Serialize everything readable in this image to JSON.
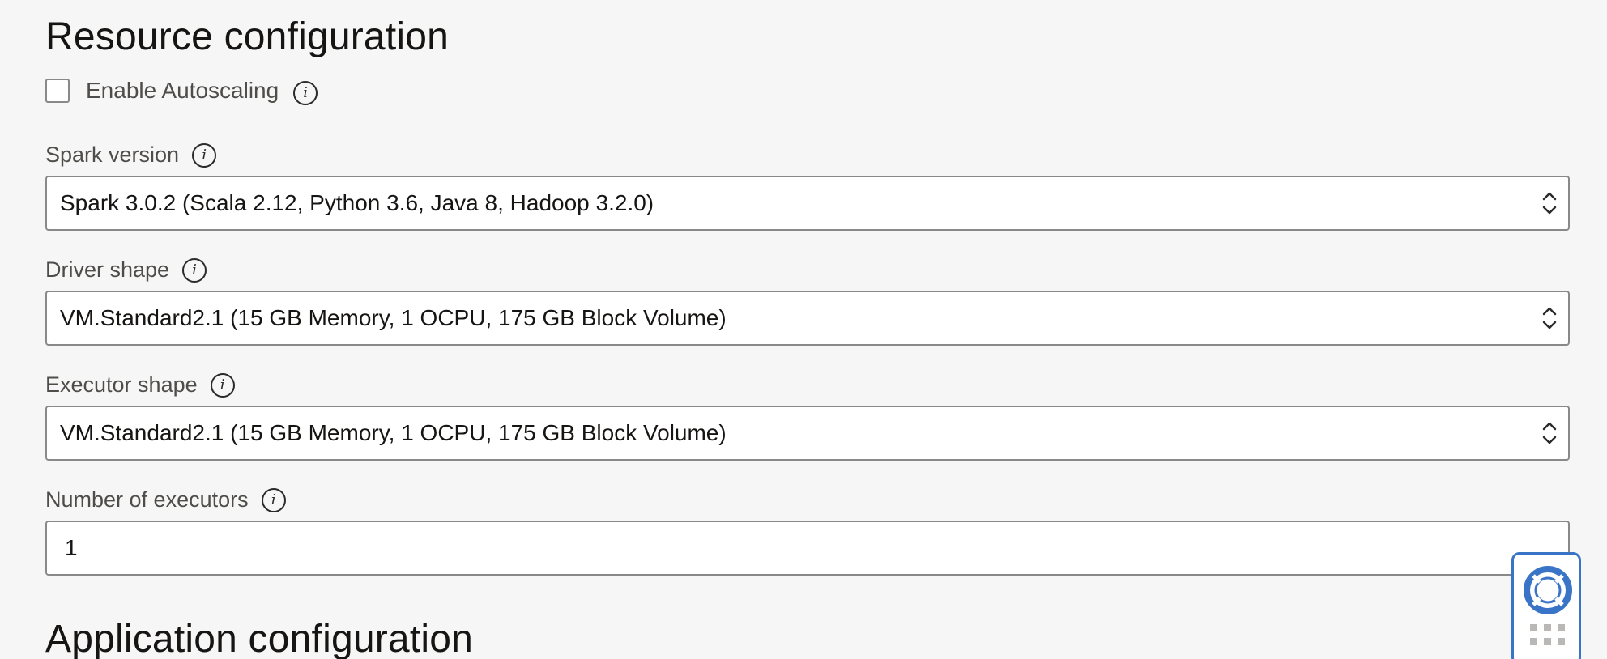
{
  "resource_section": {
    "title": "Resource configuration",
    "autoscaling": {
      "label": "Enable Autoscaling",
      "checked": false
    },
    "spark_version": {
      "label": "Spark version",
      "value": "Spark 3.0.2 (Scala 2.12, Python 3.6, Java 8, Hadoop 3.2.0)"
    },
    "driver_shape": {
      "label": "Driver shape",
      "value": "VM.Standard2.1 (15 GB Memory, 1 OCPU, 175 GB Block Volume)"
    },
    "executor_shape": {
      "label": "Executor shape",
      "value": "VM.Standard2.1 (15 GB Memory, 1 OCPU, 175 GB Block Volume)"
    },
    "num_executors": {
      "label": "Number of executors",
      "value": "1"
    }
  },
  "application_section": {
    "title": "Application configuration"
  },
  "icons": {
    "info": "info-icon",
    "select_arrows": "chevron-up-down-icon",
    "help": "lifebuoy-icon",
    "grid": "grid-dots-icon"
  },
  "colors": {
    "background": "#f6f6f6",
    "border": "#8a8987",
    "accent": "#3a74c7"
  }
}
